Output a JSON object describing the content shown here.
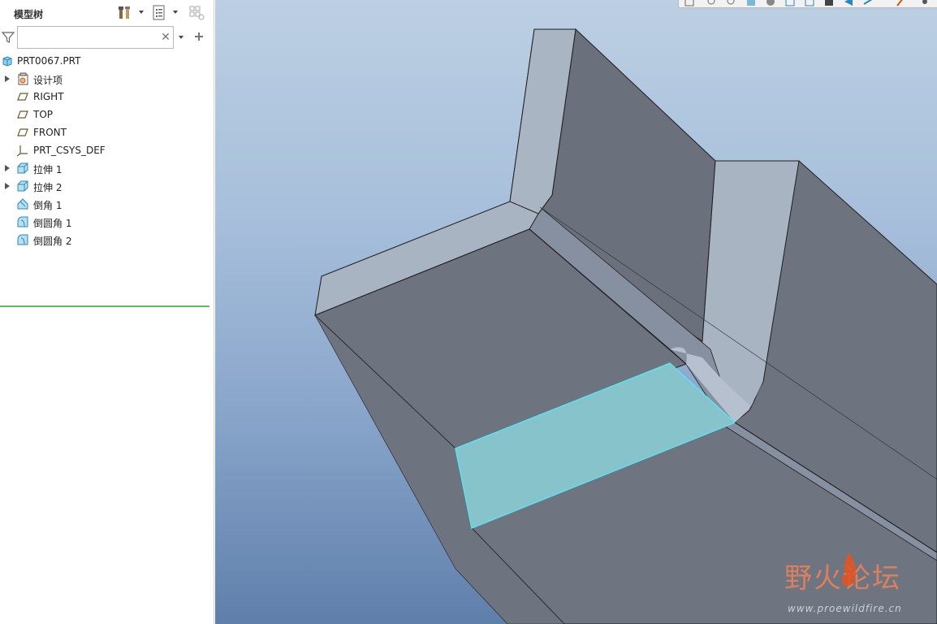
{
  "panel": {
    "title": "模型树",
    "filter": {
      "value": "",
      "placeholder": ""
    },
    "tree": [
      {
        "label": "PRT0067.PRT",
        "icon": "part-icon",
        "expandable": false
      },
      {
        "label": "设计项",
        "icon": "design-items-icon",
        "expandable": true
      },
      {
        "label": "RIGHT",
        "icon": "datum-plane-icon",
        "expandable": false
      },
      {
        "label": "TOP",
        "icon": "datum-plane-icon",
        "expandable": false
      },
      {
        "label": "FRONT",
        "icon": "datum-plane-icon",
        "expandable": false
      },
      {
        "label": "PRT_CSYS_DEF",
        "icon": "csys-icon",
        "expandable": false
      },
      {
        "label": "拉伸 1",
        "icon": "extrude-icon",
        "expandable": true
      },
      {
        "label": "拉伸 2",
        "icon": "extrude-icon",
        "expandable": true
      },
      {
        "label": "倒角 1",
        "icon": "chamfer-icon",
        "expandable": false
      },
      {
        "label": "倒圆角 1",
        "icon": "round-icon",
        "expandable": false
      },
      {
        "label": "倒圆角 2",
        "icon": "round-icon",
        "expandable": false
      }
    ]
  },
  "viewport": {
    "selection_color": "#86c3cb",
    "highlight_edge_color": "#5fe0f0"
  },
  "watermark": {
    "brand": "野火论坛",
    "url": "www.proewildfire.cn"
  }
}
